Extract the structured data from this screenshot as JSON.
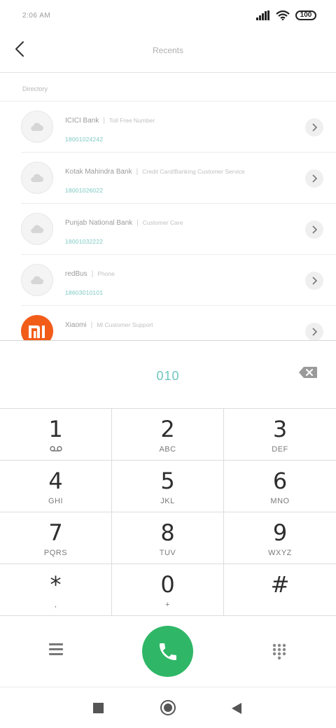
{
  "status": {
    "time": "2:06 AM",
    "battery": "100"
  },
  "header": {
    "title": "Recents"
  },
  "directory": {
    "label": "Directory",
    "entries": [
      {
        "name": "ICICI Bank",
        "tag": "Toll Free Number",
        "number": "18001024242",
        "avatar": "cloud-icon"
      },
      {
        "name": "Kotak Mahindra Bank",
        "tag": "Credit Card/Banking Customer Service",
        "number": "18001026022",
        "avatar": "cloud-icon"
      },
      {
        "name": "Punjab National Bank",
        "tag": "Customer Care",
        "number": "18001032222",
        "avatar": "cloud-icon"
      },
      {
        "name": "redBus",
        "tag": "Phone",
        "number": "18603010101",
        "avatar": "cloud-icon"
      },
      {
        "name": "Xiaomi",
        "tag": "Mi Customer Support",
        "number": "",
        "avatar": "mi-logo"
      }
    ]
  },
  "dialer": {
    "input": "010"
  },
  "keypad": [
    {
      "digit": "1",
      "letters": ""
    },
    {
      "digit": "2",
      "letters": "ABC"
    },
    {
      "digit": "3",
      "letters": "DEF"
    },
    {
      "digit": "4",
      "letters": "GHI"
    },
    {
      "digit": "5",
      "letters": "JKL"
    },
    {
      "digit": "6",
      "letters": "MNO"
    },
    {
      "digit": "7",
      "letters": "PQRS"
    },
    {
      "digit": "8",
      "letters": "TUV"
    },
    {
      "digit": "9",
      "letters": "WXYZ"
    },
    {
      "digit": "*",
      "letters": ","
    },
    {
      "digit": "0",
      "letters": "+"
    },
    {
      "digit": "#",
      "letters": ""
    }
  ],
  "colors": {
    "accent": "#6ec6be",
    "call": "#2fb767",
    "mi_brand": "#f25c19"
  }
}
